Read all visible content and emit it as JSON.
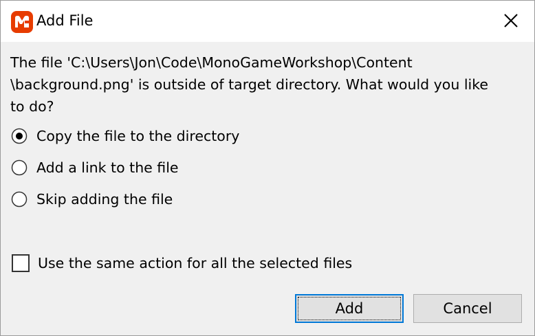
{
  "window": {
    "title": "Add File",
    "app_icon": "monogame-logo-icon",
    "close_icon": "close-icon",
    "brand_color": "#e73c00"
  },
  "message": {
    "lines": [
      "The file 'C:\\Users\\Jon\\Code\\MonoGameWorkshop\\Content",
      "\\background.png' is outside of target directory. What would you like",
      "to do?"
    ]
  },
  "options": [
    {
      "label": "Copy the file to the directory",
      "selected": true
    },
    {
      "label": "Add a link to the file",
      "selected": false
    },
    {
      "label": "Skip adding the file",
      "selected": false
    }
  ],
  "same_action": {
    "label": "Use the same action for all the selected files",
    "checked": false
  },
  "buttons": {
    "add": "Add",
    "cancel": "Cancel"
  }
}
